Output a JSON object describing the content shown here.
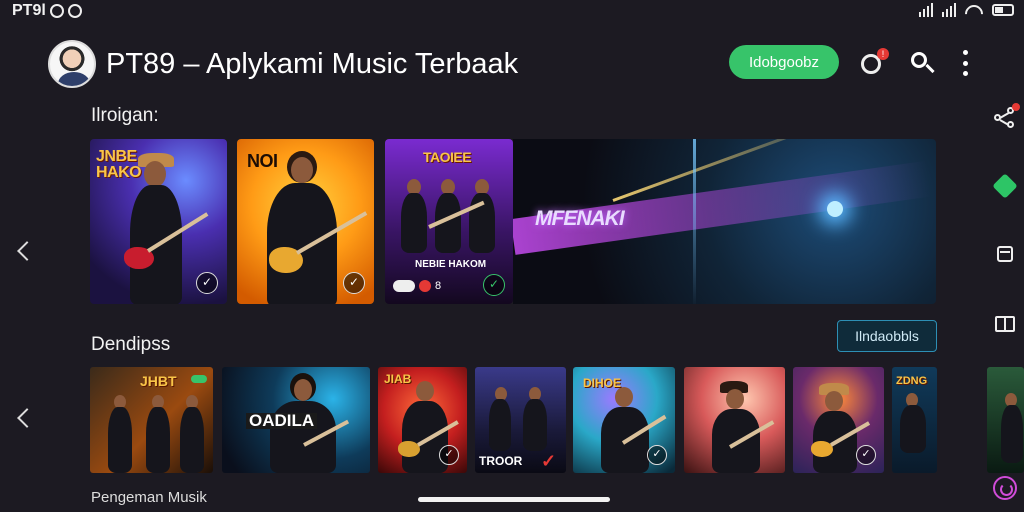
{
  "status_bar": {
    "left_text": "PT9l"
  },
  "header": {
    "title": "PT89 – Aplykami Music Terbaak",
    "green_button": "Idobgoobz",
    "notification_badge": "!"
  },
  "featured": {
    "label": "Ilroigan:",
    "cards": [
      {
        "caption": "JNBE HAKO",
        "accent": "#4a2fb0"
      },
      {
        "caption": "NOI",
        "accent": "#ff9b16"
      },
      {
        "caption": "TAOIEE",
        "small_text": "NEBIE HAKOM",
        "count": "8",
        "accent": "#7a2bd0"
      }
    ],
    "banner_title": "MFENAKI"
  },
  "second_row": {
    "label": "Dendipss",
    "button": "Ilndaobbls",
    "thumbs": [
      {
        "caption": "JHBT",
        "accent": "#7a3a10"
      },
      {
        "caption": "OADILA",
        "accent": "#0e3b5a"
      },
      {
        "caption": "JIAB",
        "accent": "#c41f1f"
      },
      {
        "caption": "TROOR",
        "accent": "#3a3a8a"
      },
      {
        "caption": "DIHOE",
        "accent": "#2aa8c8"
      },
      {
        "caption": "",
        "accent": "#d85a5a"
      },
      {
        "caption": "",
        "accent": "#2b2358"
      },
      {
        "caption": "ZDNG",
        "accent": "#103a5a"
      }
    ]
  },
  "footer_label": "Pengeman Musik",
  "colors": {
    "primary_green": "#37c46a",
    "background": "#1c1a22",
    "notification_red": "#e53935",
    "accent_magenta": "#d04cd8"
  }
}
